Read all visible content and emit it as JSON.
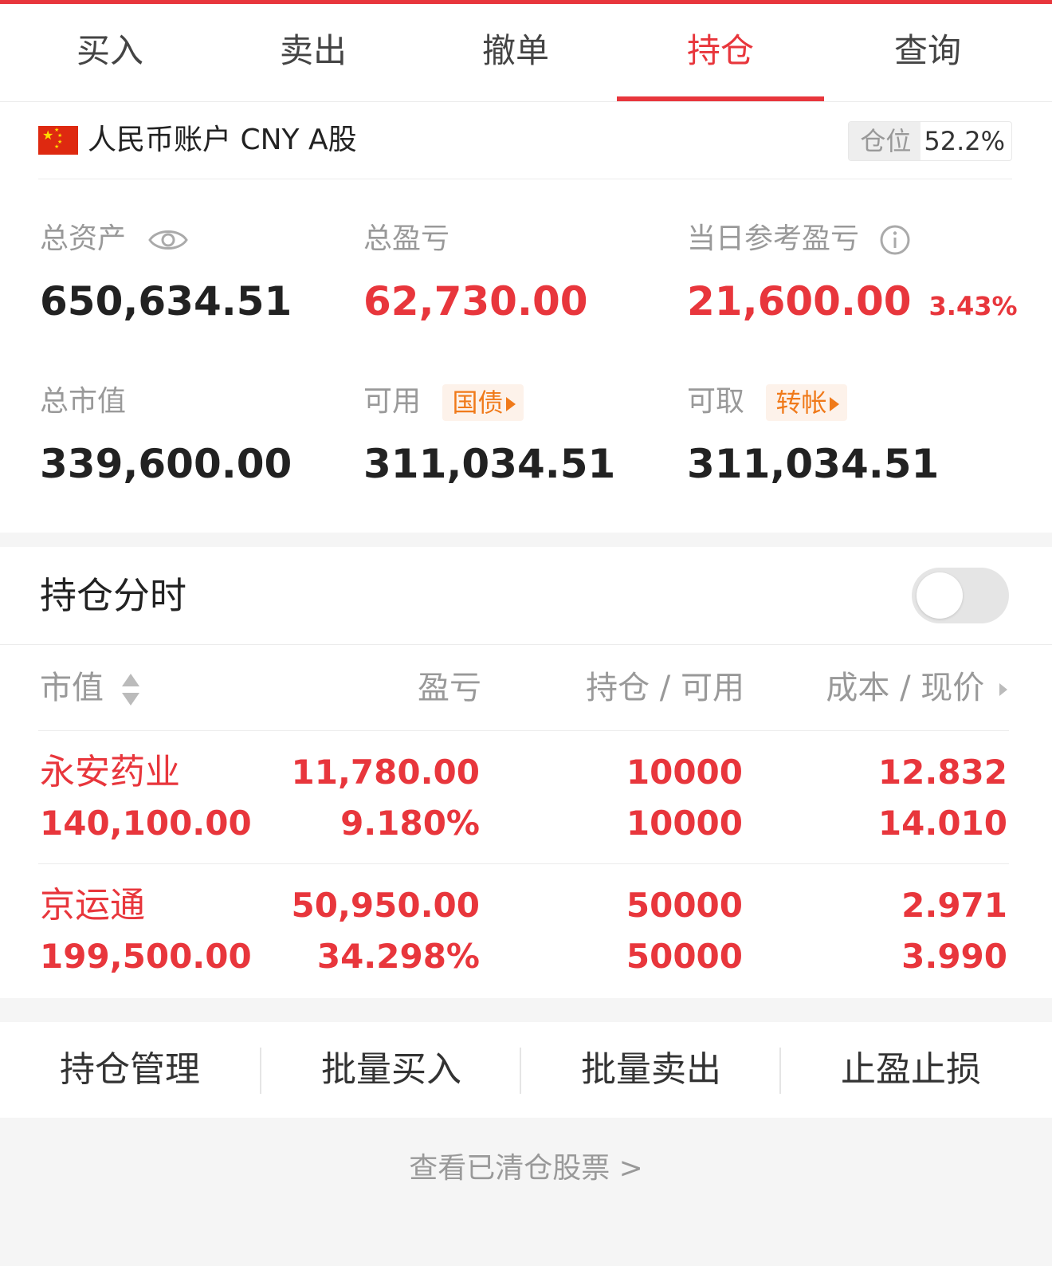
{
  "tabs": [
    {
      "label": "买入"
    },
    {
      "label": "卖出"
    },
    {
      "label": "撤单"
    },
    {
      "label": "持仓"
    },
    {
      "label": "查询"
    }
  ],
  "active_tab": "持仓",
  "account": {
    "name": "人民币账户 CNY A股",
    "position_label": "仓位",
    "position_value": "52.2%"
  },
  "summary": {
    "total_assets_label": "总资产",
    "total_assets": "650,634.51",
    "total_pnl_label": "总盈亏",
    "total_pnl": "62,730.00",
    "daily_pnl_label": "当日参考盈亏",
    "daily_pnl": "21,600.00",
    "daily_pnl_pct": "3.43%",
    "market_value_label": "总市值",
    "market_value": "339,600.00",
    "available_label": "可用",
    "available_tag": "国债",
    "available": "311,034.51",
    "withdrawable_label": "可取",
    "withdrawable_tag": "转帐",
    "withdrawable": "311,034.51"
  },
  "holdings": {
    "title": "持仓分时",
    "columns": {
      "market_value": "市值",
      "pnl": "盈亏",
      "position": "持仓 / 可用",
      "cost_price": "成本 / 现价"
    },
    "rows": [
      {
        "name": "永安药业",
        "market_value": "140,100.00",
        "pnl": "11,780.00",
        "pnl_pct": "9.180%",
        "position": "10000",
        "available": "10000",
        "cost": "12.832",
        "price": "14.010"
      },
      {
        "name": "京运通",
        "market_value": "199,500.00",
        "pnl": "50,950.00",
        "pnl_pct": "34.298%",
        "position": "50000",
        "available": "50000",
        "cost": "2.971",
        "price": "3.990"
      }
    ]
  },
  "actions": [
    {
      "label": "持仓管理"
    },
    {
      "label": "批量买入"
    },
    {
      "label": "批量卖出"
    },
    {
      "label": "止盈止损"
    }
  ],
  "footer_link": "查看已清仓股票 >",
  "colors": {
    "accent": "#e8363c",
    "tag": "#f07a1a",
    "muted": "#999999"
  },
  "icons": [
    "cn-flag-icon",
    "eye-icon",
    "info-icon",
    "sort-arrows-icon",
    "chevron-right-icon",
    "triangle-right-icon"
  ]
}
